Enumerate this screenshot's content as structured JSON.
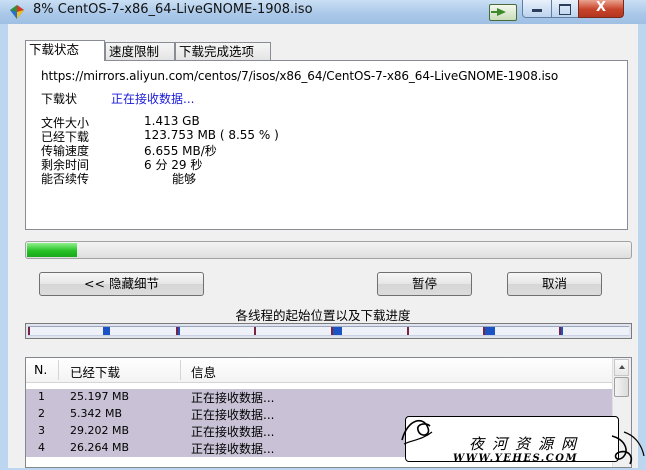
{
  "window": {
    "title": "8% CentOS-7-x86_64-LiveGNOME-1908.iso",
    "min_glyph": "",
    "close_glyph": "X"
  },
  "tabs": [
    {
      "label": "下载状态"
    },
    {
      "label": "速度限制"
    },
    {
      "label": "下载完成选项"
    }
  ],
  "status": {
    "url": "https://mirrors.aliyun.com/centos/7/isos/x86_64/CentOS-7-x86_64-LiveGNOME-1908.iso",
    "status_label": "下载状",
    "status_value": "正在接收数据...",
    "rows": [
      {
        "label": "文件大小",
        "value": "1.413  GB"
      },
      {
        "label": "已经下载",
        "value": "123.753  MB  ( 8.55 % )"
      },
      {
        "label": "传输速度",
        "value": "6.655  MB/秒"
      },
      {
        "label": "剩余时间",
        "value": "6 分 29 秒"
      },
      {
        "label": "能否续传",
        "value": "能够"
      }
    ]
  },
  "progress": {
    "percent": 8.55
  },
  "buttons": {
    "hide_details": "<< 隐藏细节",
    "pause": "暂停",
    "cancel": "取消"
  },
  "threads": {
    "title": "各线程的起始位置以及下载进度",
    "colors": {
      "start_marker": "#7b2342",
      "progress": "#1c53c4",
      "track": "#eef1f8"
    }
  },
  "list": {
    "columns": [
      "N.",
      "已经下载",
      "信息"
    ],
    "rows": [
      {
        "n": "1",
        "downloaded": "25.197 MB",
        "info": "正在接收数据..."
      },
      {
        "n": "2",
        "downloaded": "5.342 MB",
        "info": "正在接收数据..."
      },
      {
        "n": "3",
        "downloaded": "29.202 MB",
        "info": "正在接收数据..."
      },
      {
        "n": "4",
        "downloaded": "26.264 MB",
        "info": "正在接收数据..."
      }
    ]
  },
  "watermark": {
    "title": "夜河资源网",
    "url": "WWW.YEHES.COM"
  }
}
